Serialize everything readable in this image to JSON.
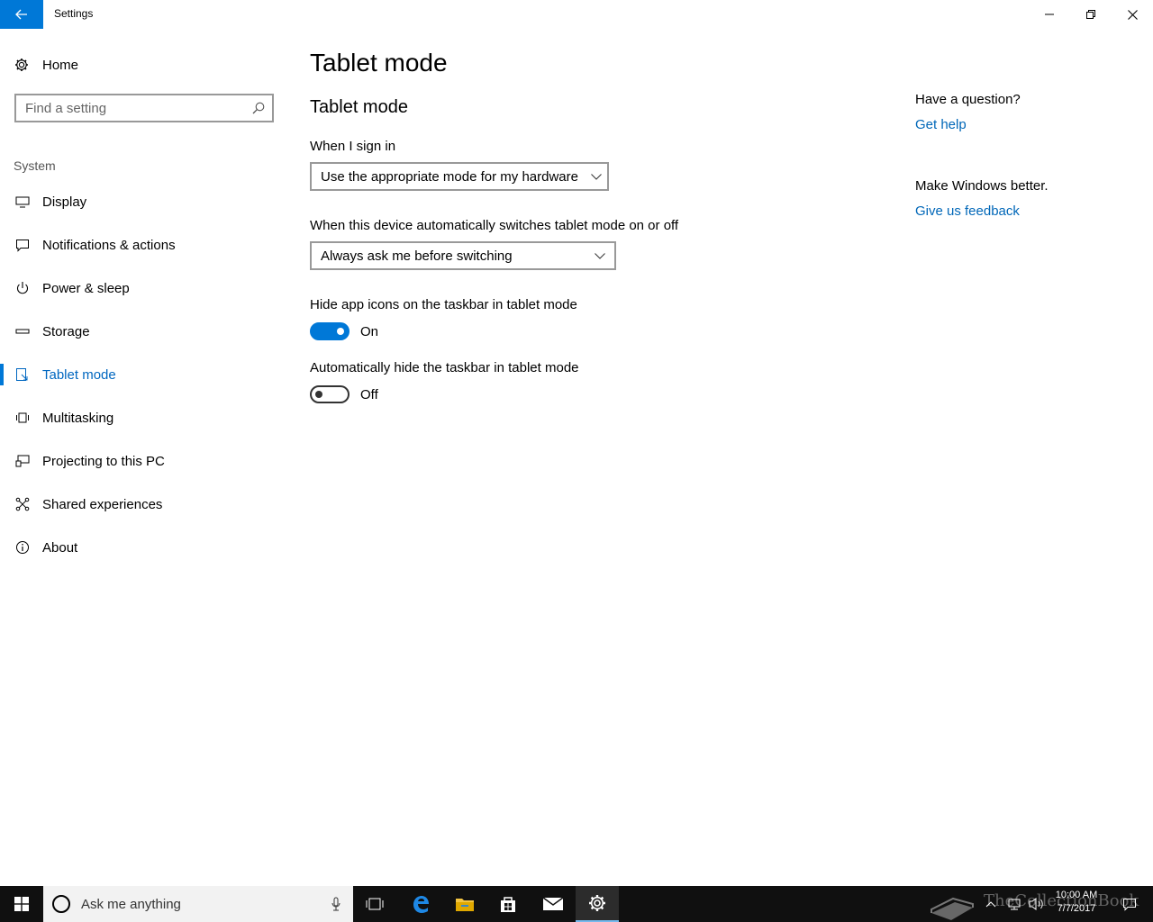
{
  "window": {
    "title": "Settings"
  },
  "sidebar": {
    "home_label": "Home",
    "search_placeholder": "Find a setting",
    "group_label": "System",
    "items": [
      {
        "label": "Display"
      },
      {
        "label": "Notifications & actions"
      },
      {
        "label": "Power & sleep"
      },
      {
        "label": "Storage"
      },
      {
        "label": "Tablet mode",
        "selected": true
      },
      {
        "label": "Multitasking"
      },
      {
        "label": "Projecting to this PC"
      },
      {
        "label": "Shared experiences"
      },
      {
        "label": "About"
      }
    ]
  },
  "main": {
    "page_title": "Tablet mode",
    "section_title": "Tablet mode",
    "sign_in": {
      "label": "When I sign in",
      "value": "Use the appropriate mode for my hardware"
    },
    "auto_switch": {
      "label": "When this device automatically switches tablet mode on or off",
      "value": "Always ask me before switching"
    },
    "hide_icons": {
      "label": "Hide app icons on the taskbar in tablet mode",
      "state": "On"
    },
    "hide_taskbar": {
      "label": "Automatically hide the taskbar in tablet mode",
      "state": "Off"
    }
  },
  "help": {
    "question": "Have a question?",
    "get_help": "Get help",
    "better": "Make Windows better.",
    "feedback": "Give us feedback"
  },
  "taskbar": {
    "search_text": "Ask me anything",
    "time": "10:00 AM",
    "date": "7/7/2017"
  },
  "watermark": {
    "text": "TheCollectionBook"
  },
  "colors": {
    "accent": "#0078d7",
    "link": "#0067b8",
    "taskbar": "#101010"
  }
}
